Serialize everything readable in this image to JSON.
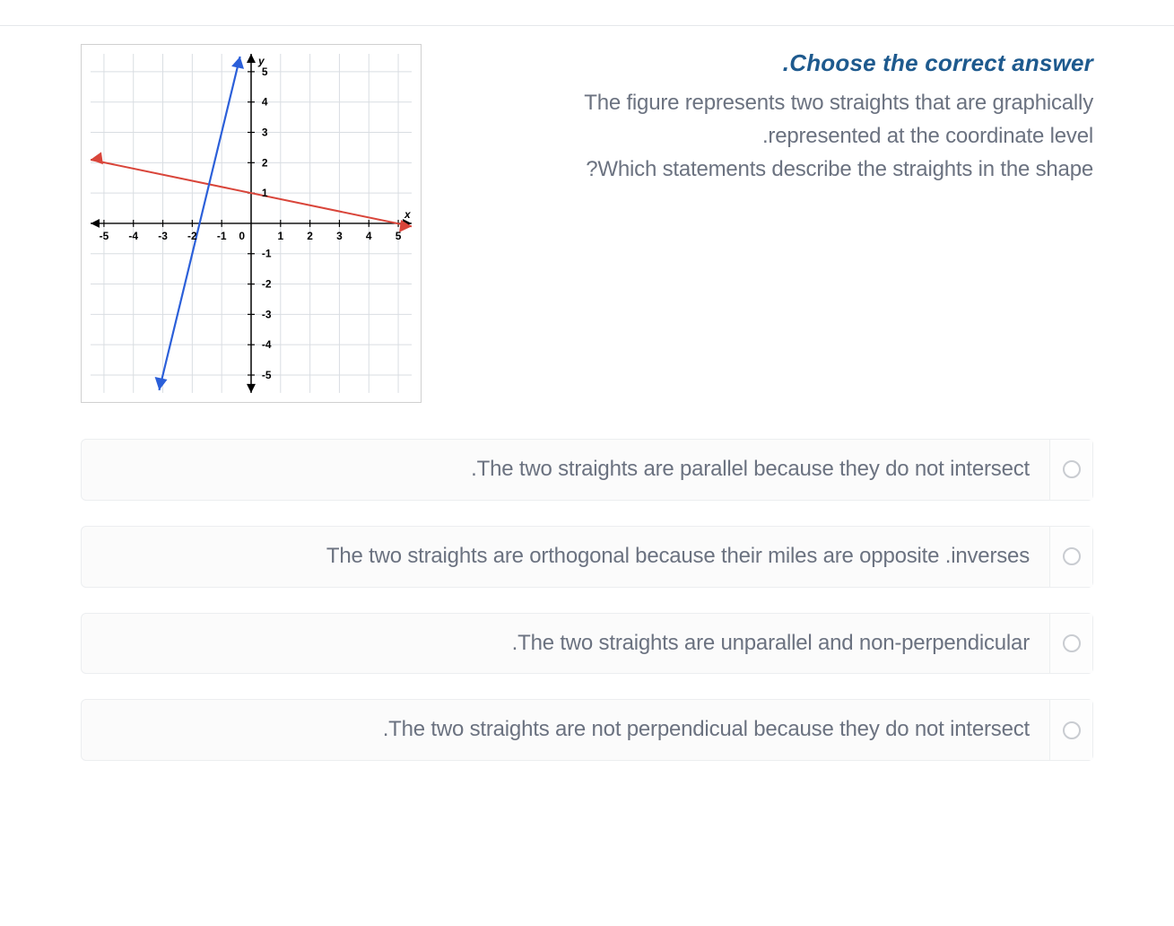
{
  "question": {
    "prompt_title": ".Choose the correct answer",
    "line1": "The figure represents two straights that are graphically",
    "line2": ".represented at the coordinate level",
    "line3": "?Which statements describe the straights in the shape"
  },
  "options": {
    "a": ".The two straights are parallel because they do not intersect",
    "b": "The two straights are orthogonal because their miles are opposite .inverses",
    "c": ".The two straights are unparallel and non-perpendicular",
    "d": ".The two straights are not perpendicual because they do not intersect"
  },
  "chart_data": {
    "type": "line",
    "xlabel": "x",
    "ylabel": "y",
    "xlim": [
      -5.5,
      5.5
    ],
    "ylim": [
      -5.5,
      5.5
    ],
    "xticks": [
      -5,
      -4,
      -3,
      -2,
      -1,
      0,
      1,
      2,
      3,
      4,
      5
    ],
    "yticks": [
      -5,
      -4,
      -3,
      -2,
      -1,
      1,
      2,
      3,
      4,
      5
    ],
    "grid": true,
    "series": [
      {
        "name": "red-line",
        "color": "#e53935",
        "points": [
          [
            -5.5,
            2.1
          ],
          [
            5.5,
            -0.1
          ]
        ],
        "slope": -0.2,
        "intercept": 1.0
      },
      {
        "name": "blue-line",
        "color": "#1e6be5",
        "points": [
          [
            -3.2,
            -5.5
          ],
          [
            -0.5,
            5.5
          ]
        ],
        "slope": 4.0,
        "intercept": 7.0
      }
    ],
    "axis_labels": {
      "x": "x",
      "y": "y",
      "origin": "0"
    }
  }
}
